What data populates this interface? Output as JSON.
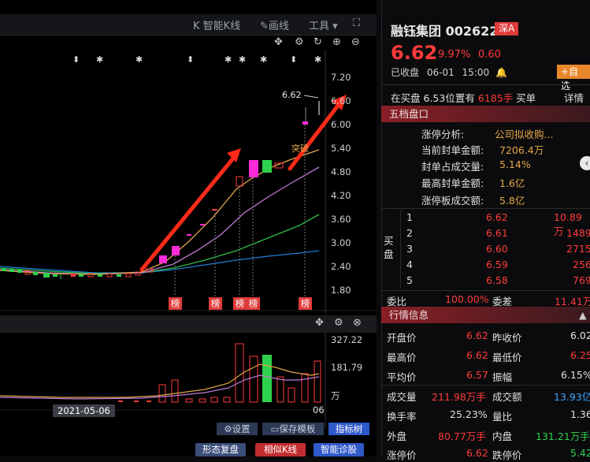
{
  "toolbar": {
    "smart_k": "智能K线",
    "draw": "画线",
    "tools": "工具",
    "k_glyph": "K"
  },
  "price_axis": [
    "7.20",
    "6.60",
    "6.00",
    "5.40",
    "4.80",
    "4.20",
    "3.60",
    "3.00",
    "2.40",
    "1.80"
  ],
  "price_label": "6.62",
  "breakout_label": "突破",
  "bang_label": "榜",
  "volume_axis": {
    "top": "327.22",
    "mid": "181.79",
    "unit": "万"
  },
  "date_label": "2021-05-06",
  "day_label": "06",
  "sub_buttons": {
    "settings": "设置",
    "save_template": "保存模板",
    "indicator_tree": "指标树"
  },
  "bottom_tabs": {
    "pattern": "形态复盘",
    "similar": "相似K线",
    "diagnose": "智能诊股"
  },
  "stock": {
    "name": "融钰集团",
    "code": "002622",
    "market": "深A",
    "price": "6.62",
    "change_pct": "9.97%",
    "change": "0.60",
    "status": "已收盘",
    "date": "06-01",
    "time": "15:00",
    "add_watch": "+自选"
  },
  "bid_line": {
    "prefix": "在买盘",
    "price": "6.53",
    "mid": "位置有",
    "volume": "6185手",
    "suffix": "买单",
    "detail": "详情"
  },
  "five_levels": {
    "header": "五档盘口",
    "limit": [
      {
        "label": "涨停分析:",
        "value": "公司拟收购..."
      },
      {
        "label": "当前封单金额:",
        "value": "7206.4万"
      },
      {
        "label": "封单占成交量:",
        "value": "5.14%"
      },
      {
        "label": "最高封单金额:",
        "value": "1.6亿"
      },
      {
        "label": "涨停板成交额:",
        "value": "5.8亿"
      }
    ],
    "buy_label": "买盘",
    "bids": [
      {
        "n": "1",
        "price": "6.62",
        "vol": "10.89万"
      },
      {
        "n": "2",
        "price": "6.61",
        "vol": "1489"
      },
      {
        "n": "3",
        "price": "6.60",
        "vol": "2715"
      },
      {
        "n": "4",
        "price": "6.59",
        "vol": "256"
      },
      {
        "n": "5",
        "price": "6.58",
        "vol": "769"
      }
    ],
    "wei_bi_label": "委比",
    "wei_bi": "100.00%",
    "wei_cha_label": "委差",
    "wei_cha": "11.41万"
  },
  "quote": {
    "header": "行情信息",
    "rows": [
      [
        {
          "k": "开盘价",
          "v": "6.62",
          "c": "red"
        },
        {
          "k": "昨收价",
          "v": "6.02",
          "c": "white"
        }
      ],
      [
        {
          "k": "最高价",
          "v": "6.62",
          "c": "red"
        },
        {
          "k": "最低价",
          "v": "6.25",
          "c": "red"
        }
      ],
      [
        {
          "k": "平均价",
          "v": "6.57",
          "c": "red"
        },
        {
          "k": "振幅",
          "v": "6.15%",
          "c": "white"
        }
      ]
    ],
    "rows2": [
      [
        {
          "k": "成交量",
          "v": "211.98万手",
          "c": "red"
        },
        {
          "k": "成交额",
          "v": "13.93亿",
          "c": "blue"
        }
      ],
      [
        {
          "k": "换手率",
          "v": "25.23%",
          "c": "white"
        },
        {
          "k": "量比",
          "v": "1.36",
          "c": "white"
        }
      ],
      [
        {
          "k": "外盘",
          "v": "80.77万手",
          "c": "red"
        },
        {
          "k": "内盘",
          "v": "131.21万手",
          "c": "green"
        }
      ],
      [
        {
          "k": "涨停价",
          "v": "6.62",
          "c": "red"
        },
        {
          "k": "跌停价",
          "v": "5.42",
          "c": "green"
        }
      ]
    ]
  },
  "colors": {
    "up": "#ff3b3b",
    "down": "#2ed14d",
    "accent": "#e03a3a",
    "magenta": "#ff2bd6"
  }
}
